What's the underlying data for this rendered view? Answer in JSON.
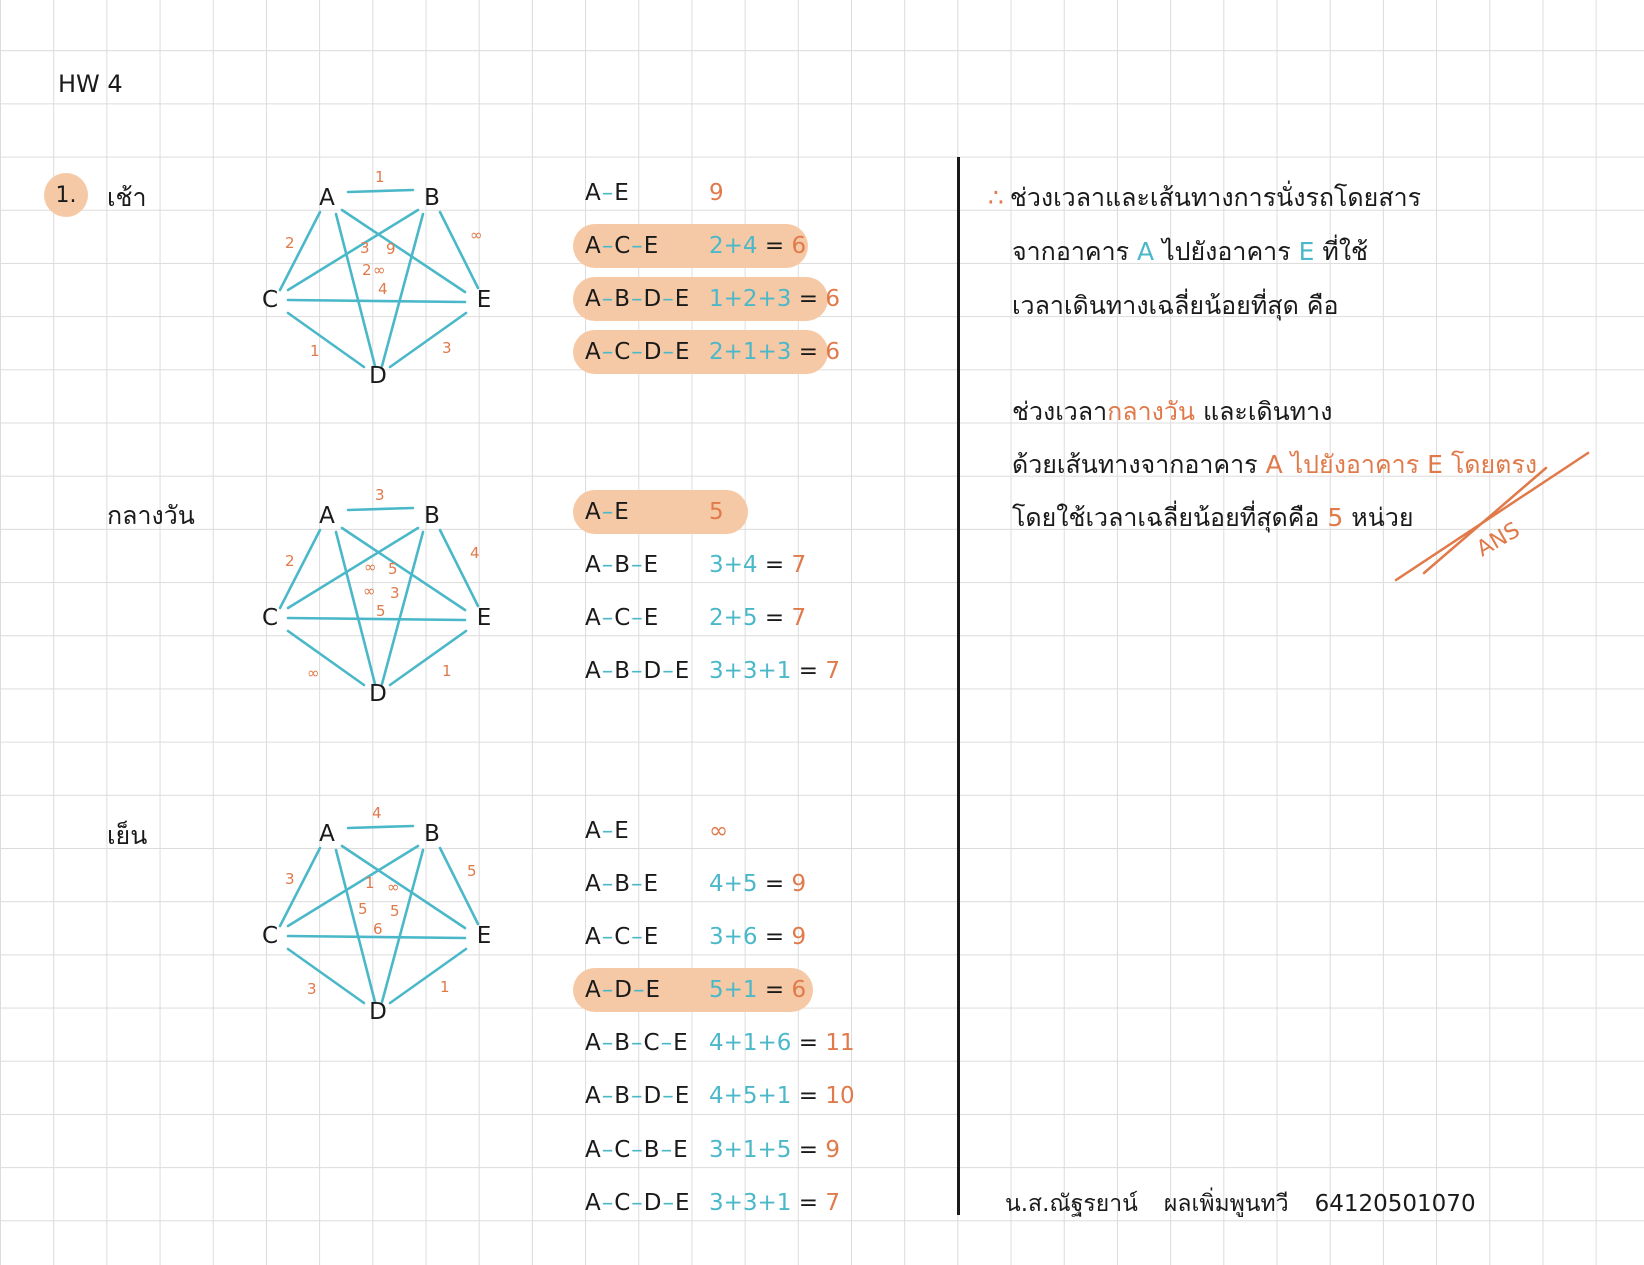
{
  "hw_title": "HW 4",
  "question_number": "1.",
  "periods": [
    {
      "label": "เช้า",
      "nodes": [
        "A",
        "B",
        "C",
        "D",
        "E"
      ],
      "weights": {
        "AB": "1",
        "AC": "2",
        "BE": "∞",
        "CD": "1",
        "DE": "3",
        "AD": "3",
        "BD": "9",
        "AE": "∞",
        "BC": "2",
        "CE": "4"
      },
      "routes": [
        {
          "path": [
            "A",
            "E"
          ],
          "calc": "",
          "result": "9"
        },
        {
          "path": [
            "A",
            "C",
            "E"
          ],
          "calc": "2+4",
          "result": "6"
        },
        {
          "path": [
            "A",
            "B",
            "D",
            "E"
          ],
          "calc": "1+2+3",
          "result": "6"
        },
        {
          "path": [
            "A",
            "C",
            "D",
            "E"
          ],
          "calc": "2+1+3",
          "result": "6"
        }
      ]
    },
    {
      "label": "กลางวัน",
      "nodes": [
        "A",
        "B",
        "C",
        "D",
        "E"
      ],
      "weights": {
        "AB": "3",
        "AC": "2",
        "BE": "4",
        "CD": "∞",
        "DE": "1",
        "AD": "∞",
        "BD": "5",
        "AE": "∞",
        "BC": "3",
        "CE": "5"
      },
      "routes": [
        {
          "path": [
            "A",
            "E"
          ],
          "calc": "",
          "result": "5"
        },
        {
          "path": [
            "A",
            "B",
            "E"
          ],
          "calc": "3+4",
          "result": "7"
        },
        {
          "path": [
            "A",
            "C",
            "E"
          ],
          "calc": "2+5",
          "result": "7"
        },
        {
          "path": [
            "A",
            "B",
            "D",
            "E"
          ],
          "calc": "3+3+1",
          "result": "7"
        }
      ]
    },
    {
      "label": "เย็น",
      "nodes": [
        "A",
        "B",
        "C",
        "D",
        "E"
      ],
      "weights": {
        "AB": "4",
        "AC": "3",
        "BE": "5",
        "CD": "3",
        "DE": "1",
        "AD": "1",
        "BD": "∞",
        "AE": "5",
        "BC": "5",
        "CE": "6"
      },
      "routes": [
        {
          "path": [
            "A",
            "E"
          ],
          "calc": "",
          "result": "∞"
        },
        {
          "path": [
            "A",
            "B",
            "E"
          ],
          "calc": "4+5",
          "result": "9"
        },
        {
          "path": [
            "A",
            "C",
            "E"
          ],
          "calc": "3+6",
          "result": "9"
        },
        {
          "path": [
            "A",
            "D",
            "E"
          ],
          "calc": "5+1",
          "result": "6"
        },
        {
          "path": [
            "A",
            "B",
            "C",
            "E"
          ],
          "calc": "4+1+6",
          "result": "11"
        },
        {
          "path": [
            "A",
            "B",
            "D",
            "E"
          ],
          "calc": "4+5+1",
          "result": "10"
        },
        {
          "path": [
            "A",
            "C",
            "B",
            "E"
          ],
          "calc": "3+1+5",
          "result": "9"
        },
        {
          "path": [
            "A",
            "C",
            "D",
            "E"
          ],
          "calc": "3+3+1",
          "result": "7"
        }
      ]
    }
  ],
  "answer": {
    "therefore": "∴",
    "line1": "ช่วงเวลาและเส้นทางการนั่งรถโดยสาร",
    "line2_a": "จากอาคาร",
    "line2_b": "A",
    "line2_c": "ไปยังอาคาร",
    "line2_d": "E",
    "line2_e": "ที่ใช้",
    "line3": "เวลาเดินทางเฉลี่ยน้อยที่สุด คือ",
    "line4_a": "ช่วงเวลา",
    "line4_b": "กลางวัน",
    "line4_c": "และเดินทาง",
    "line5_a": "ด้วยเส้นทางจากอาคาร",
    "line5_b": "A ไปยังอาคาร E โดยตรง",
    "line6_a": "โดยใช้เวลาเฉลี่ยน้อยที่สุดคือ",
    "line6_b": "5",
    "line6_c": "หน่วย",
    "ans_mark": "ANS"
  },
  "signature": {
    "name": "น.ส.ณัฐรยาน์",
    "surname": "ผลเพิ่มพูนทวี",
    "student_id": "64120501070"
  },
  "colors": {
    "teal": "#4bb8c9",
    "orange": "#e07a4a",
    "highlight": "#f6c9a6"
  }
}
